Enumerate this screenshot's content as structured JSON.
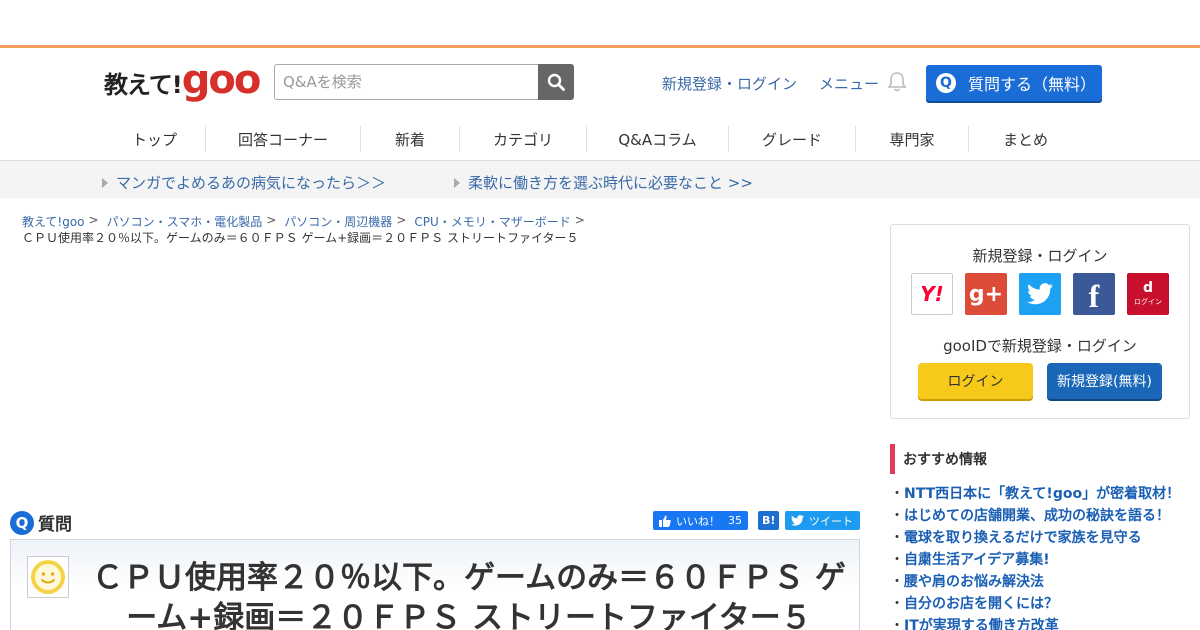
{
  "logo": {
    "text_jp": "教えて!",
    "text_goo": "goo"
  },
  "search": {
    "placeholder": "Q&Aを検索"
  },
  "header_links": {
    "register_login": "新規登録・ログイン",
    "menu": "メニュー"
  },
  "ask_button": {
    "icon_letter": "Q",
    "label": "質問する（無料）"
  },
  "nav": [
    {
      "label": "トップ"
    },
    {
      "label": "回答コーナー"
    },
    {
      "label": "新着"
    },
    {
      "label": "カテゴリ"
    },
    {
      "label": "Q&Aコラム"
    },
    {
      "label": "グレード"
    },
    {
      "label": "専門家"
    },
    {
      "label": "まとめ"
    }
  ],
  "promos": [
    {
      "label": "マンガでよめるあの病気になったら＞＞"
    },
    {
      "label": "柔軟に働き方を選ぶ時代に必要なこと >>"
    }
  ],
  "breadcrumb": [
    {
      "label": "教えて!goo"
    },
    {
      "label": "パソコン・スマホ・電化製品"
    },
    {
      "label": "パソコン・周辺機器"
    },
    {
      "label": "CPU・メモリ・マザーボード"
    }
  ],
  "breadcrumb_sep": ">",
  "breadcrumb_current": "ＣＰＵ使用率２０％以下。ゲームのみ＝６０ＦＰＳ ゲーム+録画＝２０ＦＰＳ ストリートファイター５",
  "question": {
    "icon_letter": "Q",
    "heading": "質問",
    "title": "ＣＰＵ使用率２０％以下。ゲームのみ＝６０ＦＰＳ ゲーム+録画＝２０ＦＰＳ ストリートファイター５"
  },
  "social": {
    "like_label": "いいね！",
    "like_count": "35",
    "hatena_label": "B!",
    "tweet_label": "ツイート"
  },
  "sidebar_login": {
    "heading": "新規登録・ログイン",
    "sns": [
      {
        "name": "yahoo-icon",
        "label": "Y!"
      },
      {
        "name": "google-plus-icon",
        "label": "g+"
      },
      {
        "name": "twitter-icon",
        "label": ""
      },
      {
        "name": "facebook-icon",
        "label": "f"
      },
      {
        "name": "docomo-d-icon",
        "label": "d",
        "sub": "ログイン"
      }
    ],
    "gooid_text": "gooIDで新規登録・ログイン",
    "login_label": "ログイン",
    "register_label": "新規登録(無料)"
  },
  "recommend": {
    "heading": "おすすめ情報",
    "items": [
      "NTT西日本に「教えて!goo」が密着取材！",
      "はじめての店舗開業、成功の秘訣を語る！",
      "電球を取り換えるだけで家族を見守る",
      "自粛生活アイデア募集!",
      "腰や肩のお悩み解決法",
      "自分のお店を開くには？",
      "ITが実現する働き方改革"
    ]
  },
  "colors": {
    "accent_orange": "#f59b5e",
    "brand_red": "#d7302a",
    "primary_blue": "#1a6dd6",
    "link_blue": "#3a6aa8",
    "login_yellow": "#f7c91b",
    "rec_pink": "#e0395a"
  }
}
